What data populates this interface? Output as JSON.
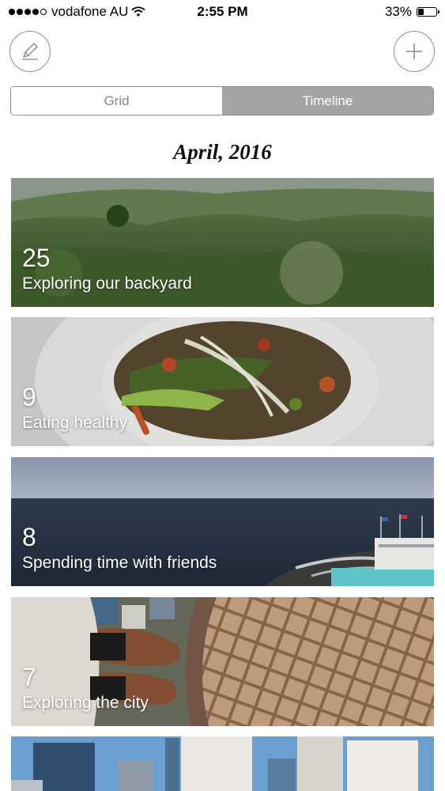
{
  "status_bar": {
    "carrier": "vodafone AU",
    "time": "2:55 PM",
    "battery_text": "33%",
    "battery_level": 0.33
  },
  "toolbar": {
    "left_icon": "pencil-icon",
    "right_icon": "plus-icon"
  },
  "segmented_control": {
    "grid_label": "Grid",
    "timeline_label": "Timeline",
    "selected": "Timeline"
  },
  "month_title": "April, 2016",
  "entries": [
    {
      "day": "25",
      "title": "Exploring our backyard"
    },
    {
      "day": "9",
      "title": "Eating healthy"
    },
    {
      "day": "8",
      "title": "Spending time with friends"
    },
    {
      "day": "7",
      "title": "Exploring the city"
    }
  ],
  "colors": {
    "segment_active": "#a4a4a6",
    "segment_inactive_text": "#8a8a8a",
    "border": "#8c8c8c"
  }
}
